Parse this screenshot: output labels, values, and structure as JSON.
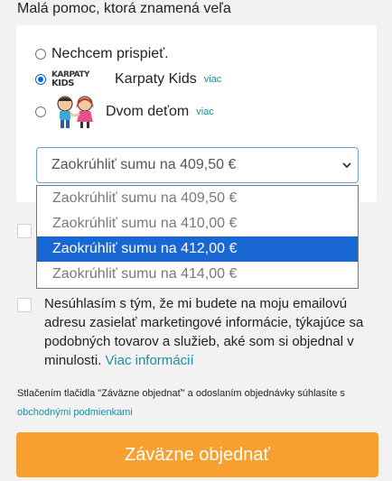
{
  "section": {
    "heading": "Malá pomoc, ktorá znamená veľa"
  },
  "donation": {
    "options": [
      {
        "label": "Nechcem prispieť.",
        "checked": false
      },
      {
        "label": "Karpaty Kids",
        "more": "viac",
        "checked": true,
        "logo_text": [
          "KARPATY",
          "KIDS"
        ]
      },
      {
        "label": "Dvom deťom",
        "more": "viac",
        "checked": false
      }
    ],
    "select_value": "Zaokrúhliť sumu na 409,50 €",
    "dropdown_options": [
      "Zaokrúhliť sumu na 409,50 €",
      "Zaokrúhliť sumu na 410,00 €",
      "Zaokrúhliť sumu na 412,00 €",
      "Zaokrúhliť sumu na 414,00 €"
    ],
    "highlighted_option": "Zaokrúhliť sumu na 412,00 €"
  },
  "consent": {
    "text": "Nesúhlasím s tým, že mi budete na moju emailovú adresu zasielať marketingové informácie, týkajúce sa podobných tovarov a služieb, aké som si objednal v minulosti.",
    "link": "Viac informácií",
    "checked": false
  },
  "terms": {
    "text": "Stlačením tlačidla \"Záväzne objednať\" a odoslaním objednávky súhlasíte s",
    "link": "obchodnými podmienkami"
  },
  "order_button": {
    "label": "Záväzne objednať"
  },
  "colors": {
    "accent": "#f7a030",
    "link": "#1c8ea3",
    "highlight": "#1967d2"
  }
}
